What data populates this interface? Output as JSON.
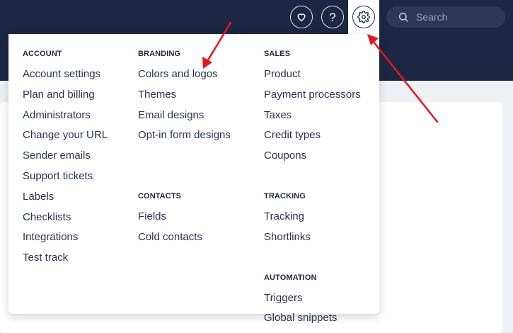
{
  "topbar": {
    "search_placeholder": "Search",
    "help_label": "?"
  },
  "menu": {
    "account": {
      "heading": "ACCOUNT",
      "items": [
        "Account settings",
        "Plan and billing",
        "Administrators",
        "Change your URL",
        "Sender emails",
        "Support tickets",
        "Labels",
        "Checklists",
        "Integrations",
        "Test track"
      ]
    },
    "branding": {
      "heading": "BRANDING",
      "items": [
        "Colors and logos",
        "Themes",
        "Email designs",
        "Opt-in form designs"
      ]
    },
    "contacts": {
      "heading": "CONTACTS",
      "items": [
        "Fields",
        "Cold contacts"
      ]
    },
    "sales": {
      "heading": "SALES",
      "items": [
        "Product",
        "Payment processors",
        "Taxes",
        "Credit types",
        "Coupons"
      ]
    },
    "tracking": {
      "heading": "TRACKING",
      "items": [
        "Tracking",
        "Shortlinks"
      ]
    },
    "automation": {
      "heading": "AUTOMATION",
      "items": [
        "Triggers",
        "Global snippets"
      ]
    }
  },
  "icons": {
    "heart": "heart-icon",
    "help": "help-icon",
    "settings": "gear-icon",
    "search": "search-icon"
  },
  "colors": {
    "navbar": "#1c2744",
    "text": "#2a3350",
    "annotation": "#e8141c"
  }
}
